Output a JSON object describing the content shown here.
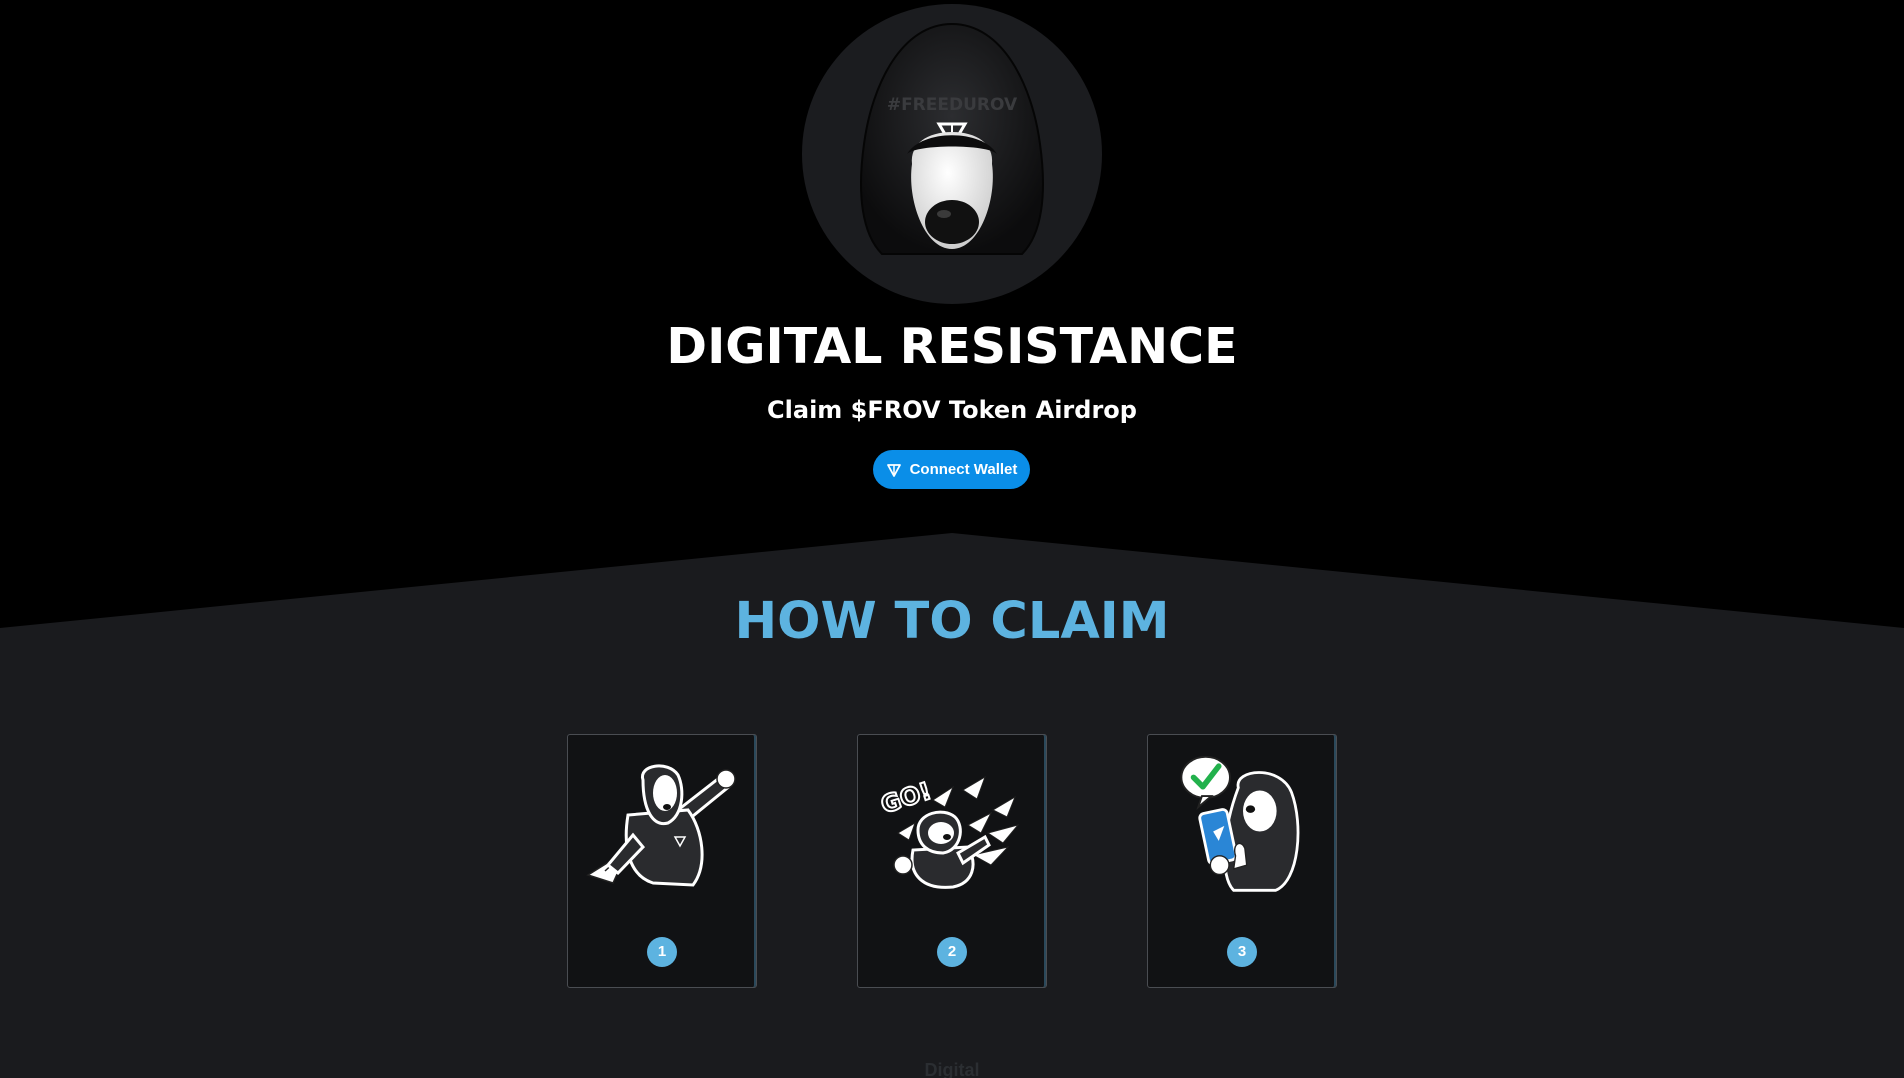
{
  "hero": {
    "title": "DIGITAL RESISTANCE",
    "subtitle": "Claim $FROV Token Airdrop",
    "connect_label": "Connect Wallet",
    "avatar_hood_text": "#FREEDUROV"
  },
  "how_to_claim": {
    "title": "HOW TO CLAIM",
    "steps": [
      {
        "number": "1"
      },
      {
        "number": "2",
        "art_text": "GO!"
      },
      {
        "number": "3"
      }
    ]
  },
  "footer": {
    "peek_text": "Digital"
  },
  "colors": {
    "background_top": "#000000",
    "background_lower": "#1a1b1e",
    "accent_blue": "#0a8ee8",
    "title_blue": "#5db3e0",
    "text_white": "#ffffff"
  },
  "icons": [
    "ton-diamond-icon",
    "hooded-dog-avatar",
    "sticker-dog-paper-plane",
    "sticker-dog-go",
    "sticker-dog-phone-check"
  ]
}
